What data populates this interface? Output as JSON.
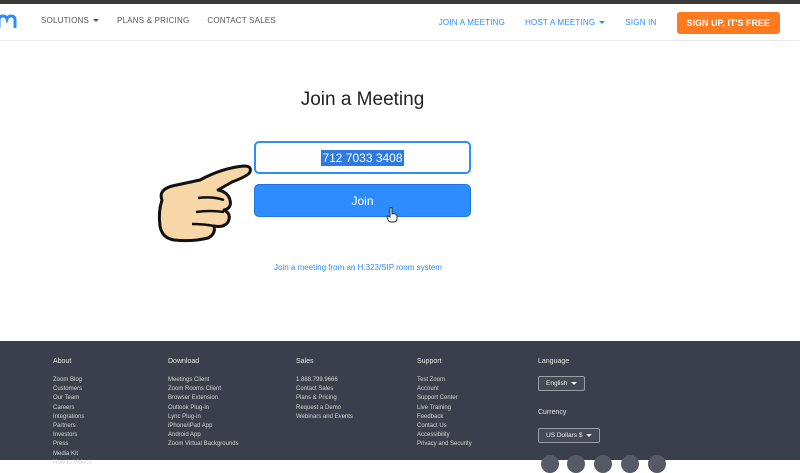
{
  "nav": {
    "left": [
      {
        "label": "SOLUTIONS",
        "dropdown": true
      },
      {
        "label": "PLANS & PRICING",
        "dropdown": false
      },
      {
        "label": "CONTACT SALES",
        "dropdown": false
      }
    ],
    "join_meeting": "JOIN A MEETING",
    "host_meeting": "HOST A MEETING",
    "sign_in": "SIGN IN",
    "signup": "SIGN UP, IT'S FREE"
  },
  "main": {
    "title": "Join a Meeting",
    "meeting_id": "712 7033 3408",
    "join_label": "Join",
    "sip_link": "Join a meeting from an H.323/SIP room system"
  },
  "footer": {
    "about": {
      "heading": "About",
      "items": [
        "Zoom Blog",
        "Customers",
        "Our Team",
        "Careers",
        "Integrations",
        "Partners",
        "Investors",
        "Press",
        "Media Kit",
        "How to Videos"
      ]
    },
    "download": {
      "heading": "Download",
      "items": [
        "Meetings Client",
        "Zoom Rooms Client",
        "Browser Extension",
        "Outlook Plug-in",
        "Lync Plug-in",
        "iPhone/iPad App",
        "Android App",
        "Zoom Virtual Backgrounds"
      ]
    },
    "sales": {
      "heading": "Sales",
      "items": [
        "1.888.799.9666",
        "Contact Sales",
        "Plans & Pricing",
        "Request a Demo",
        "Webinars and Events"
      ]
    },
    "support": {
      "heading": "Support",
      "items": [
        "Test Zoom",
        "Account",
        "Support Center",
        "Live Training",
        "Feedback",
        "Contact Us",
        "Accessibility",
        "Privacy and Security"
      ]
    },
    "language": {
      "heading": "Language",
      "value": "English"
    },
    "currency": {
      "heading": "Currency",
      "value": "US Dollars $"
    }
  },
  "colors": {
    "brand_blue": "#2d8cff",
    "signup_orange": "#ff7a1f",
    "footer_bg": "#3a3f4b"
  }
}
